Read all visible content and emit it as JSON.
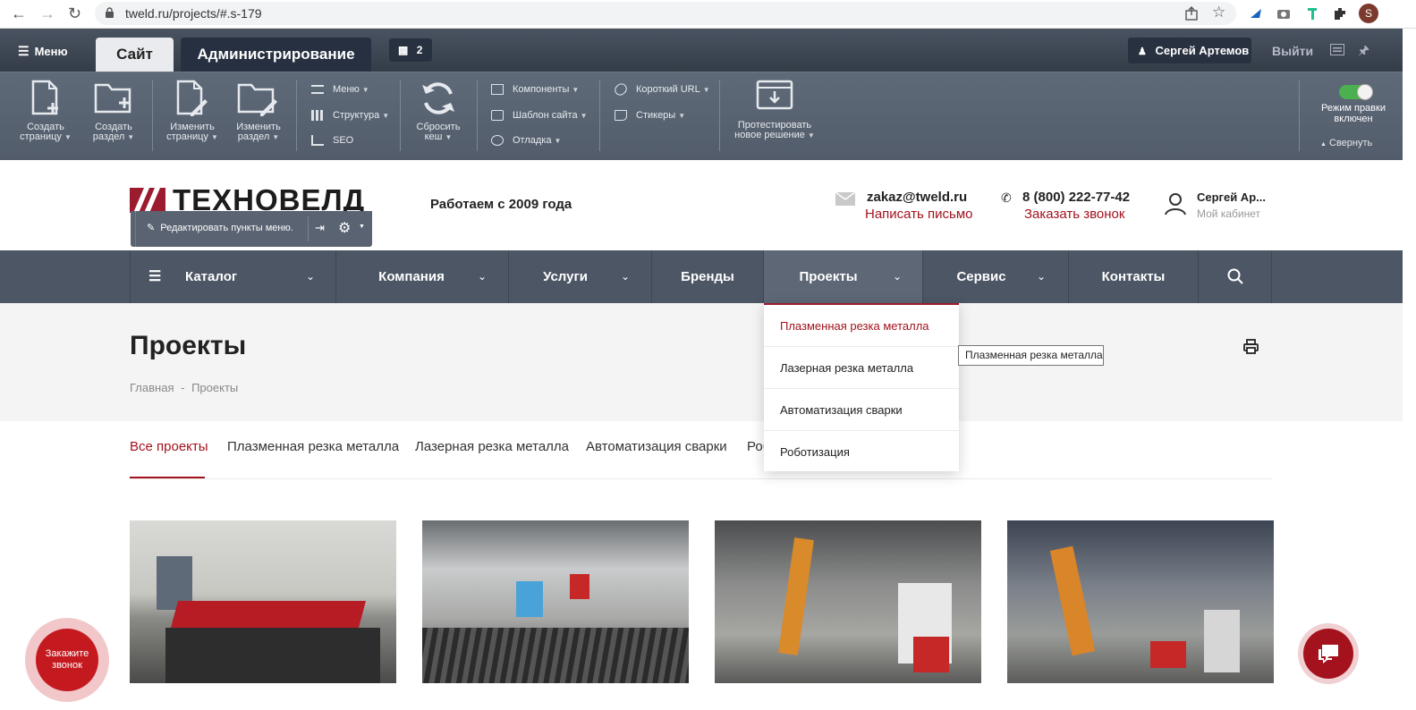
{
  "browser": {
    "url": "tweld.ru/projects/#.s-179",
    "avatar_letter": "S"
  },
  "admin": {
    "menu_label": "Меню",
    "tab_site": "Сайт",
    "tab_admin": "Администрирование",
    "notifications_count": "2",
    "user_name": "Сергей Артемов",
    "logout": "Выйти",
    "tools": {
      "create_page": [
        "Создать",
        "страницу"
      ],
      "create_section": [
        "Создать",
        "раздел"
      ],
      "edit_page": [
        "Изменить",
        "страницу"
      ],
      "edit_section": [
        "Изменить",
        "раздел"
      ],
      "menu": "Меню",
      "structure": "Структура",
      "seo": "SEO",
      "reset_cache": [
        "Сбросить",
        "кеш"
      ],
      "components": "Компоненты",
      "site_template": "Шаблон сайта",
      "debug": "Отладка",
      "short_url": "Короткий URL",
      "stickers": "Стикеры",
      "test_solution": [
        "Протестировать",
        "новое решение"
      ]
    },
    "edit_mode": [
      "Режим правки",
      "включен"
    ],
    "collapse": "Свернуть"
  },
  "header": {
    "logo_text": "ТЕХНОВЕЛД",
    "edit_menu_items": "Редактировать пункты меню.",
    "since": "Работаем с 2009 года",
    "email": "zakaz@tweld.ru",
    "write_letter": "Написать письмо",
    "phone": "8 (800) 222-77-42",
    "order_call": "Заказать звонок",
    "user_short": "Сергей Ар...",
    "cabinet": "Мой кабинет"
  },
  "nav": {
    "items": [
      "Каталог",
      "Компания",
      "Услуги",
      "Бренды",
      "Проекты",
      "Сервис",
      "Контакты"
    ]
  },
  "dropdown": {
    "items": [
      "Плазменная резка металла",
      "Лазерная резка металла",
      "Автоматизация сварки",
      "Роботизация"
    ],
    "tooltip": "Плазменная резка металла"
  },
  "page": {
    "title": "Проекты",
    "breadcrumb_home": "Главная",
    "breadcrumb_sep": "-",
    "breadcrumb_current": "Проекты"
  },
  "filters": [
    "Все проекты",
    "Плазменная резка металла",
    "Лазерная резка металла",
    "Автоматизация сварки",
    "Роб"
  ],
  "floating": {
    "call_line1": "Закажите",
    "call_line2": "звонок"
  },
  "colors": {
    "accent": "#a3121d",
    "admin_bg": "#3c4553",
    "nav_bg": "#4c5664"
  }
}
